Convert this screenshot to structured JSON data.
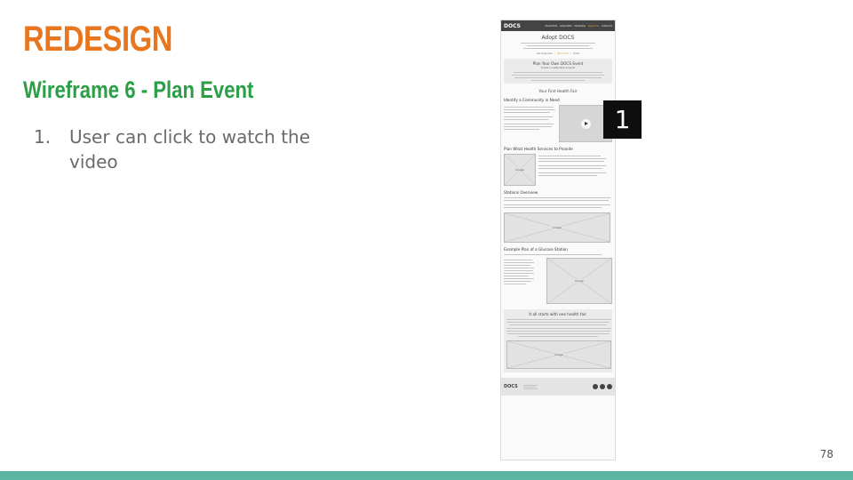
{
  "slide": {
    "title": "REDESIGN",
    "subtitle": "Wireframe 6 - Plan Event",
    "points": [
      {
        "number": "1.",
        "text": "User can click to watch the video"
      }
    ],
    "page_number": "78",
    "callout_number": "1"
  },
  "wireframe": {
    "logo": "DOCS",
    "nav": [
      "About DOCS",
      "Adopt DOCS",
      "Partnership",
      "Support Us",
      "Contact Us"
    ],
    "hero_title": "Adopt DOCS",
    "breadcrumbs": [
      "Get Organized",
      "Plan Event",
      "Finish"
    ],
    "plan_box_title": "Plan Your Own DOCS Event",
    "plan_box_sub": "Create a sustainable program",
    "section_first": "Your First Health Fair",
    "section_identify": "Identify a Community in Need",
    "section_services": "Plan What Health Services to Provide",
    "section_stations": "Stations Overview",
    "section_example": "Example Plan of a Glucose Station",
    "section_final": "It all starts with one health fair.",
    "image_label": "Image",
    "footer_logo": "DOCS"
  }
}
